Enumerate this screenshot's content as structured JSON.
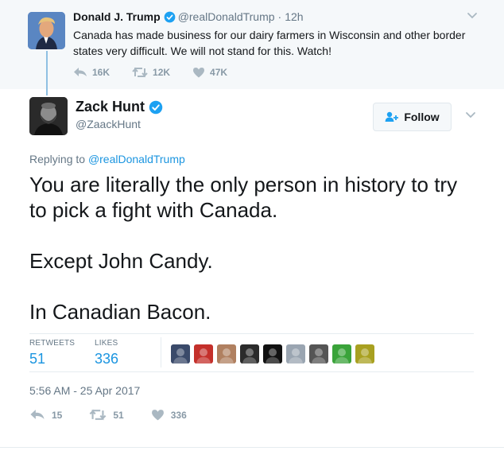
{
  "parent_tweet": {
    "name": "Donald J. Trump",
    "handle": "@realDonaldTrump",
    "separator": "·",
    "time": "12h",
    "text": "Canada has made business for our dairy farmers in Wisconsin and other border states very difficult. We will not stand for this. Watch!",
    "reply_count": "16K",
    "retweet_count": "12K",
    "like_count": "47K"
  },
  "main_tweet": {
    "name": "Zack Hunt",
    "handle": "@ZaackHunt",
    "follow_label": "Follow",
    "replying_prefix": "Replying to",
    "replying_handle": "@realDonaldTrump",
    "text_lines": [
      "You are literally the only person in history to try to pick a fight with Canada.",
      "",
      "Except John Candy.",
      "",
      "In Canadian Bacon."
    ],
    "stats": {
      "retweets_label": "RETWEETS",
      "retweets_value": "51",
      "likes_label": "LIKES",
      "likes_value": "336"
    },
    "timestamp": "5:56 AM - 25 Apr 2017",
    "actions": {
      "reply_count": "15",
      "retweet_count": "51",
      "like_count": "336"
    }
  },
  "colors": {
    "accent": "#1b95e0",
    "verified": "#1da1f2",
    "muted": "#657786",
    "parent_bg": "#f5f8fa"
  },
  "likers": [
    {
      "color": "#3a4a6a"
    },
    {
      "color": "#c4302b"
    },
    {
      "color": "#b08060"
    },
    {
      "color": "#2b2b2b"
    },
    {
      "color": "#111111"
    },
    {
      "color": "#9aa5b1"
    },
    {
      "color": "#555555"
    },
    {
      "color": "#3aa33a"
    },
    {
      "color": "#a8a020"
    }
  ]
}
